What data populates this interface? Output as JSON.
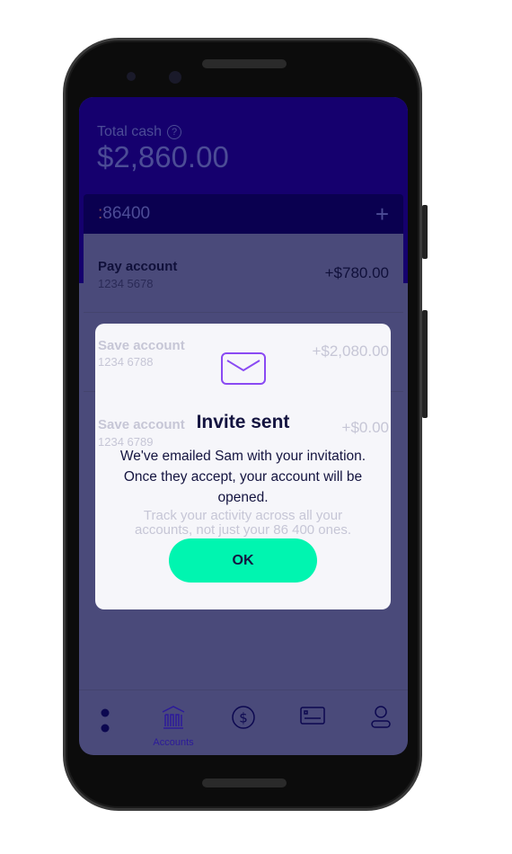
{
  "header": {
    "total_label": "Total cash",
    "total_value": "$2,860.00"
  },
  "accounts_card": {
    "brand_prefix": ":",
    "brand": "86400"
  },
  "accounts": [
    {
      "name": "Pay account",
      "number": "1234 5678",
      "amount": "+$780.00"
    },
    {
      "name": "Save account",
      "number": "1234 6788",
      "amount": "+$2,080.00"
    },
    {
      "name": "Save account",
      "number": "1234 6789",
      "amount": "+$0.00"
    }
  ],
  "track_text": "Track your activity across all your accounts, not just your 86 400 ones.",
  "modal": {
    "icon": "envelope-icon",
    "title": "Invite sent",
    "body": "We've emailed Sam with your invitation. Once they accept, your account will be opened.",
    "ok_label": "OK"
  },
  "nav": {
    "items": [
      "menu",
      "accounts",
      "payments",
      "cards",
      "profile"
    ],
    "active_label": "Accounts"
  },
  "colors": {
    "accent": "#00f5b0",
    "icon": "#8a4af3",
    "hero": "#15006e",
    "text": "#141440"
  }
}
